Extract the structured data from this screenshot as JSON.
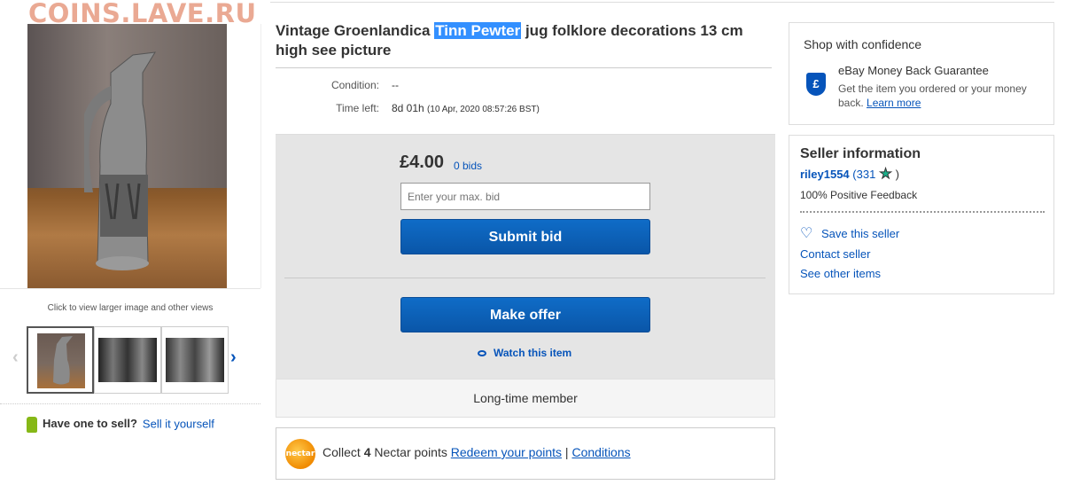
{
  "watermark": "COINS.LAVE.RU",
  "gallery": {
    "caption": "Click to view larger image and other views"
  },
  "sell": {
    "prompt": "Have one to sell?",
    "link": "Sell it yourself"
  },
  "listing": {
    "title_pre": "Vintage Groenlandica ",
    "title_highlight": "Tinn Pewter",
    "title_post": " jug folklore decorations 13 cm high see picture",
    "condition_label": "Condition:",
    "condition_value": "--",
    "time_left_label": "Time left:",
    "time_left_value": "8d 01h",
    "time_left_detail": "(10 Apr, 2020   08:57:26 BST)"
  },
  "bid": {
    "price": "£4.00",
    "bids": "0 bids",
    "input_placeholder": "Enter your max. bid",
    "submit_label": "Submit bid",
    "offer_label": "Make offer",
    "watch_label": "Watch this item",
    "member_text": "Long-time member"
  },
  "nectar": {
    "logo_text": "nectar",
    "collect_pre": "Collect ",
    "points": "4",
    "collect_post": " Nectar points ",
    "redeem": "Redeem your points",
    "sep": " | ",
    "conditions": "Conditions"
  },
  "confidence": {
    "heading": "Shop with confidence",
    "guarantee": "eBay Money Back Guarantee",
    "desc": "Get the item you ordered or your money back.",
    "learn_more": "Learn more"
  },
  "seller": {
    "heading": "Seller information",
    "name": "riley1554",
    "count_open": "(331",
    "count_close": ")",
    "feedback": "100% Positive Feedback",
    "save": "Save this seller",
    "contact": "Contact seller",
    "other": "See other items"
  }
}
